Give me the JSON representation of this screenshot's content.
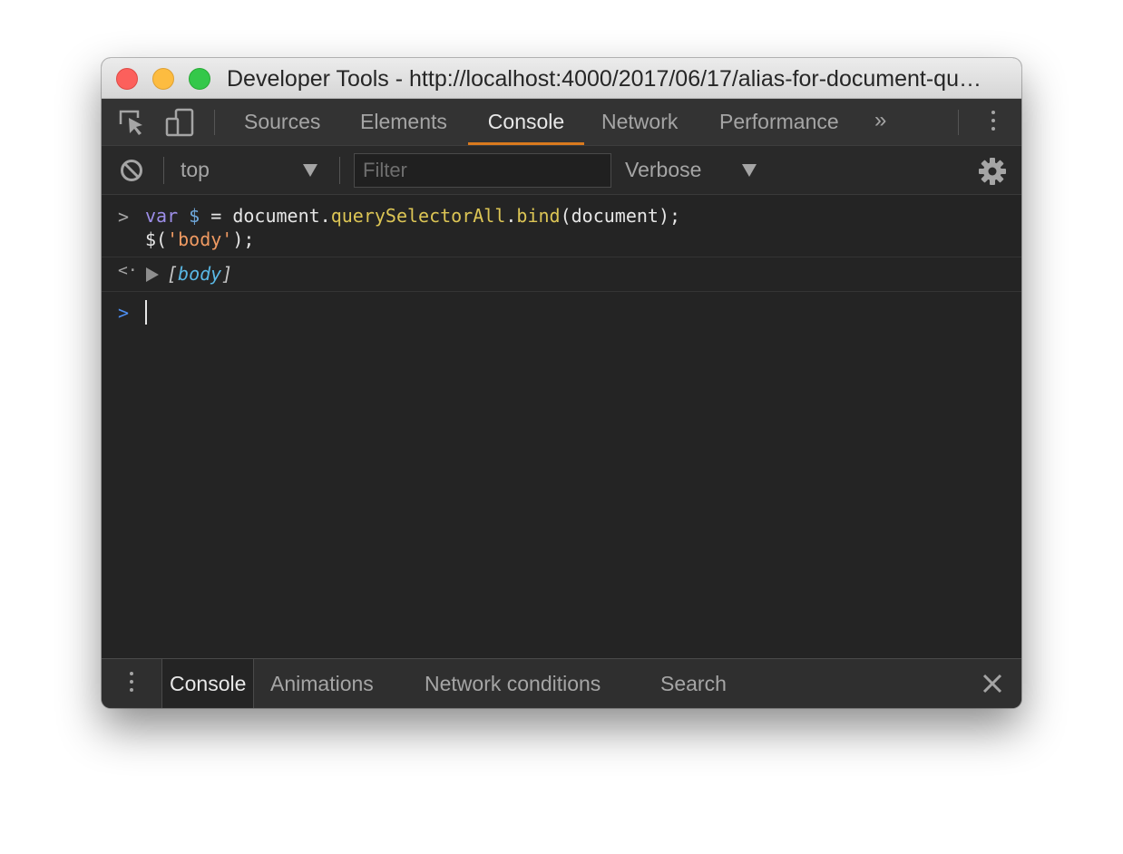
{
  "window": {
    "title": "Developer Tools - http://localhost:4000/2017/06/17/alias-for-document-queryselectorall/"
  },
  "titlebar": {
    "buttons": [
      "close",
      "minimize",
      "zoom"
    ]
  },
  "tabs": [
    {
      "label": "Sources",
      "active": false
    },
    {
      "label": "Elements",
      "active": false
    },
    {
      "label": "Console",
      "active": true
    },
    {
      "label": "Network",
      "active": false
    },
    {
      "label": "Performance",
      "active": false
    }
  ],
  "more_tabs": "»",
  "toolbar": {
    "context": "top",
    "filter_placeholder": "Filter",
    "filter_value": "",
    "level": "Verbose"
  },
  "console": {
    "input_line1": {
      "kw": "var",
      "var": "$",
      "op": " = ",
      "obj": "document.",
      "fn1": "querySelectorAll",
      "dot": ".",
      "fn2": "bind",
      "args": "(document);"
    },
    "input_line2": {
      "pre": "$(",
      "str": "'body'",
      "post": ");"
    },
    "result": {
      "open": "[",
      "name": "body",
      "close": "]"
    }
  },
  "drawer": {
    "tabs": [
      {
        "label": "Console",
        "active": true
      },
      {
        "label": "Animations",
        "active": false
      },
      {
        "label": "Network conditions",
        "active": false
      },
      {
        "label": "Search",
        "active": false
      }
    ]
  },
  "colors": {
    "tab_active_underline": "#d97a1e",
    "keyword": "#9d8ee8",
    "function": "#dcc555",
    "string": "#ef9a62",
    "object": "#5ab9e6",
    "prompt": "#4d8ef0"
  }
}
